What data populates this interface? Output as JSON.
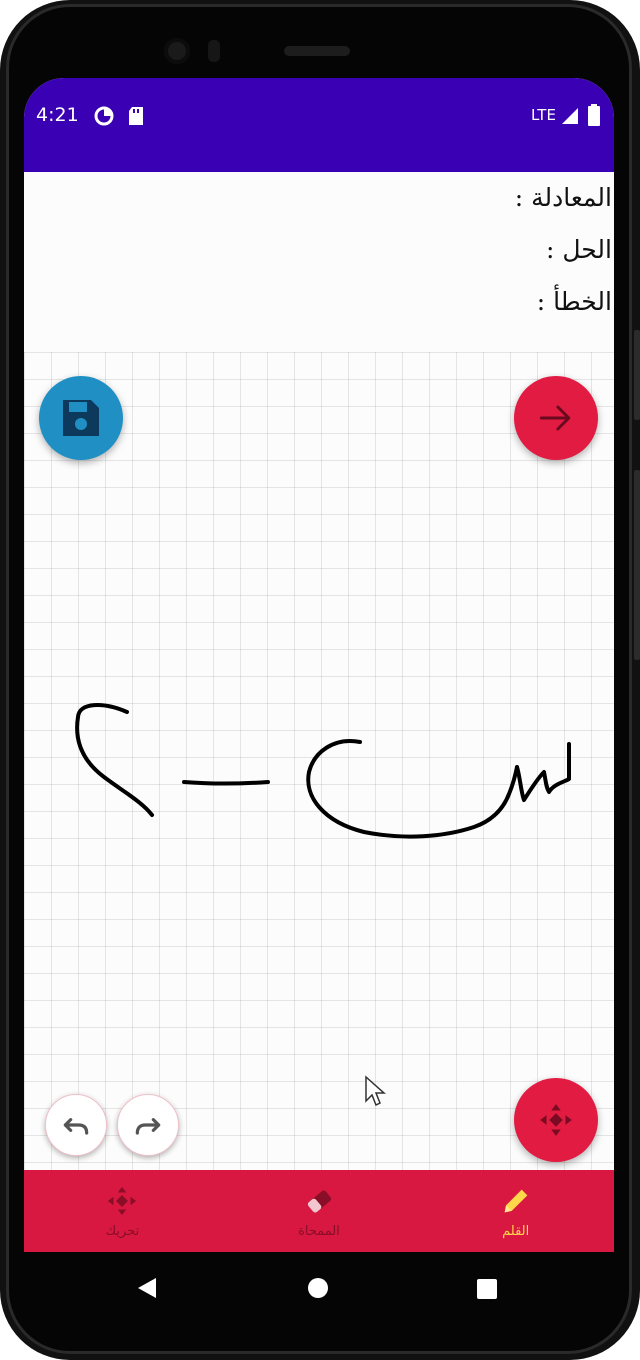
{
  "status_bar": {
    "time": "4:21",
    "network": "LTE",
    "background_color": "#3a00b3"
  },
  "info_panel": {
    "equation_label": "المعادلة :",
    "solution_label": "الحل :",
    "error_label": "الخطأ :"
  },
  "canvas": {
    "ink_color": "#000000",
    "grid_color": "#d9d9d9"
  },
  "fabs": {
    "save_icon": "floppy-disk-icon",
    "next_icon": "arrow-right-icon",
    "move_icon": "move-arrows-icon",
    "undo_icon": "undo-icon",
    "redo_icon": "redo-icon",
    "accent_color": "#e11b42",
    "save_color": "#1f8fc4"
  },
  "bottom_nav": {
    "items": [
      {
        "label": "تحريك",
        "icon": "move-arrows-icon",
        "active": false
      },
      {
        "label": "الممحاة",
        "icon": "eraser-icon",
        "active": false
      },
      {
        "label": "القلم",
        "icon": "pencil-icon",
        "active": true
      }
    ],
    "background_color": "#d81840",
    "inactive_color": "#8a0e27",
    "active_color": "#ffd84a"
  }
}
